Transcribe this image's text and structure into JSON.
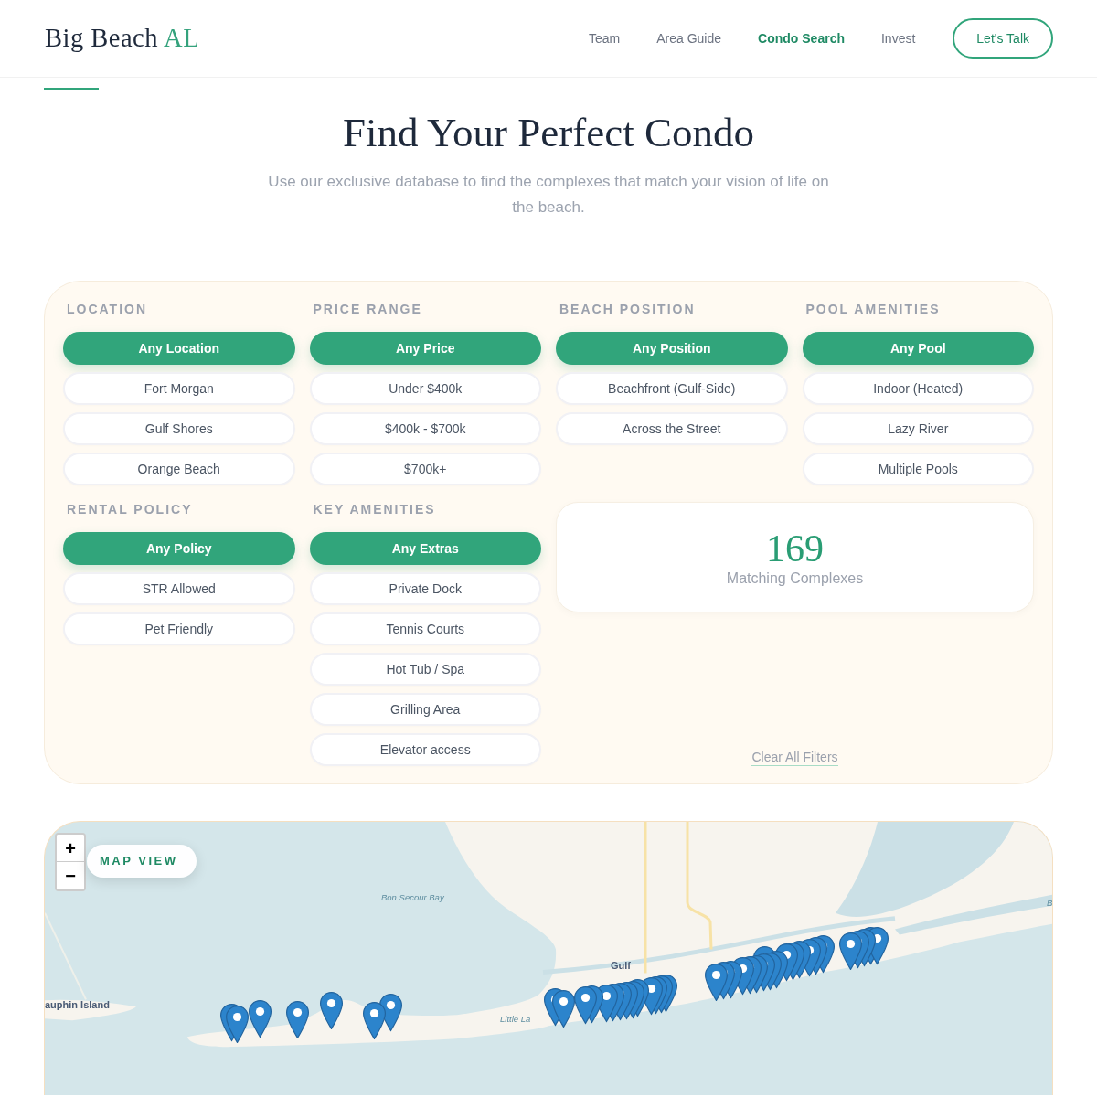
{
  "header": {
    "logo": {
      "text": "Big Beach",
      "accent": "AL"
    },
    "nav": [
      {
        "label": "Team",
        "selected": false
      },
      {
        "label": "Area Guide",
        "selected": false
      },
      {
        "label": "Condo Search",
        "selected": true
      },
      {
        "label": "Invest",
        "selected": false
      }
    ],
    "cta": "Let's Talk"
  },
  "hero": {
    "title": "Find Your Perfect Condo",
    "subtitle": "Use our exclusive database to find the complexes that match your vision of life on the beach."
  },
  "filters": {
    "groups": [
      {
        "heading": "LOCATION",
        "options": [
          {
            "label": "Any Location",
            "selected": true
          },
          {
            "label": "Fort Morgan",
            "selected": false
          },
          {
            "label": "Gulf Shores",
            "selected": false
          },
          {
            "label": "Orange Beach",
            "selected": false
          }
        ]
      },
      {
        "heading": "PRICE RANGE",
        "options": [
          {
            "label": "Any Price",
            "selected": true
          },
          {
            "label": "Under $400k",
            "selected": false
          },
          {
            "label": "$400k - $700k",
            "selected": false
          },
          {
            "label": "$700k+",
            "selected": false
          }
        ]
      },
      {
        "heading": "BEACH POSITION",
        "options": [
          {
            "label": "Any Position",
            "selected": true
          },
          {
            "label": "Beachfront (Gulf-Side)",
            "selected": false
          },
          {
            "label": "Across the Street",
            "selected": false
          }
        ]
      },
      {
        "heading": "POOL AMENITIES",
        "options": [
          {
            "label": "Any Pool",
            "selected": true
          },
          {
            "label": "Indoor (Heated)",
            "selected": false
          },
          {
            "label": "Lazy River",
            "selected": false
          },
          {
            "label": "Multiple Pools",
            "selected": false
          }
        ]
      },
      {
        "heading": "RENTAL POLICY",
        "options": [
          {
            "label": "Any Policy",
            "selected": true
          },
          {
            "label": "STR Allowed",
            "selected": false
          },
          {
            "label": "Pet Friendly",
            "selected": false
          }
        ]
      },
      {
        "heading": "KEY AMENITIES",
        "options": [
          {
            "label": "Any Extras",
            "selected": true
          },
          {
            "label": "Private Dock",
            "selected": false
          },
          {
            "label": "Tennis Courts",
            "selected": false
          },
          {
            "label": "Hot Tub / Spa",
            "selected": false
          },
          {
            "label": "Grilling Area",
            "selected": false
          },
          {
            "label": "Elevator access",
            "selected": false
          }
        ]
      }
    ],
    "result": {
      "count": "169",
      "label": "Matching Complexes"
    },
    "clear_link": "Clear All Filters"
  },
  "map": {
    "zoom_in": "+",
    "zoom_out": "−",
    "badge": "MAP VIEW",
    "labels": [
      {
        "text": "Bon Secour Bay",
        "kind": "water"
      },
      {
        "text": "B",
        "kind": "water"
      },
      {
        "text": "Gulf",
        "kind": "place"
      },
      {
        "text": "auphin Island",
        "kind": "place"
      },
      {
        "text": "Little La",
        "kind": "water"
      }
    ]
  }
}
